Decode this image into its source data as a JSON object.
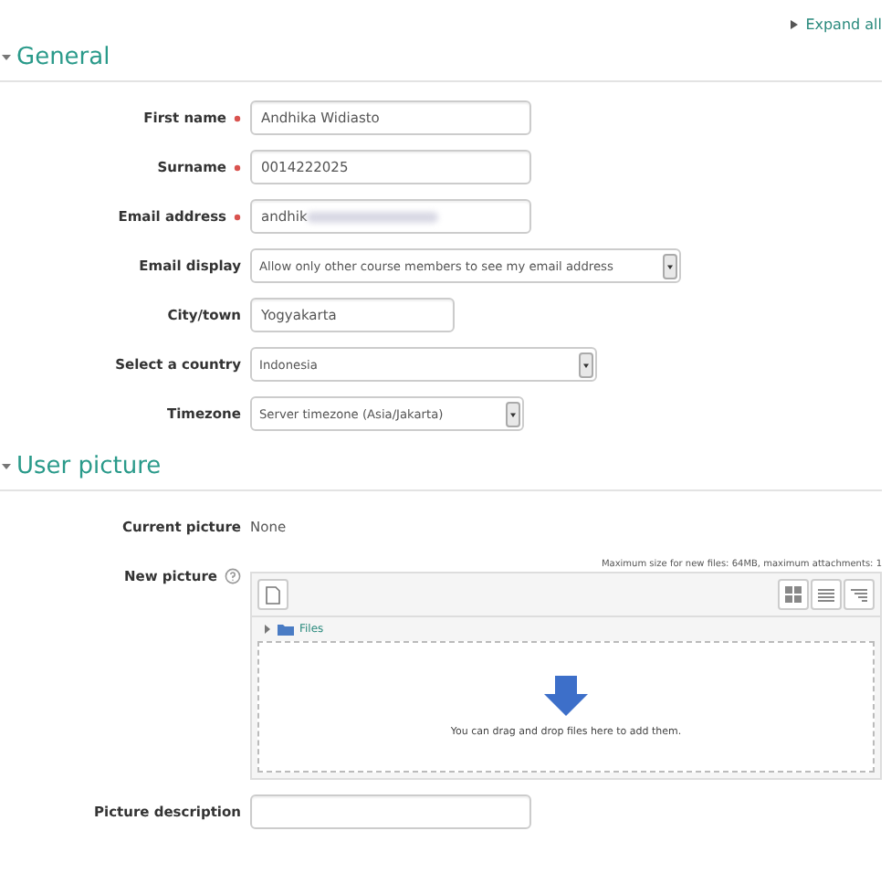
{
  "expand_all": {
    "label": "Expand all"
  },
  "sections": [
    {
      "title": "General",
      "expanded": true,
      "fields": [
        {
          "kind": "text",
          "label": "First name",
          "required": true,
          "value": "Andhika Widiasto"
        },
        {
          "kind": "text",
          "label": "Surname",
          "required": true,
          "value": "0014222025"
        },
        {
          "kind": "text",
          "label": "Email address",
          "required": true,
          "value": "andhik",
          "redacted": true
        },
        {
          "kind": "select",
          "label": "Email display",
          "value": "Allow only other course members to see my email address"
        },
        {
          "kind": "text",
          "label": "City/town",
          "value": "Yogyakarta"
        },
        {
          "kind": "select",
          "label": "Select a country",
          "value": "Indonesia"
        },
        {
          "kind": "select",
          "label": "Timezone",
          "value": "Server timezone (Asia/Jakarta)"
        }
      ]
    },
    {
      "title": "User picture",
      "expanded": true,
      "fields": [
        {
          "kind": "static",
          "label": "Current picture",
          "value": "None"
        },
        {
          "kind": "filepicker",
          "label": "New picture",
          "help": true,
          "note": "Maximum size for new files: 64MB, maximum attachments: 1",
          "folder": "Files",
          "drop_text": "You can drag and drop files here to add them."
        },
        {
          "kind": "text",
          "label": "Picture description"
        }
      ]
    }
  ]
}
